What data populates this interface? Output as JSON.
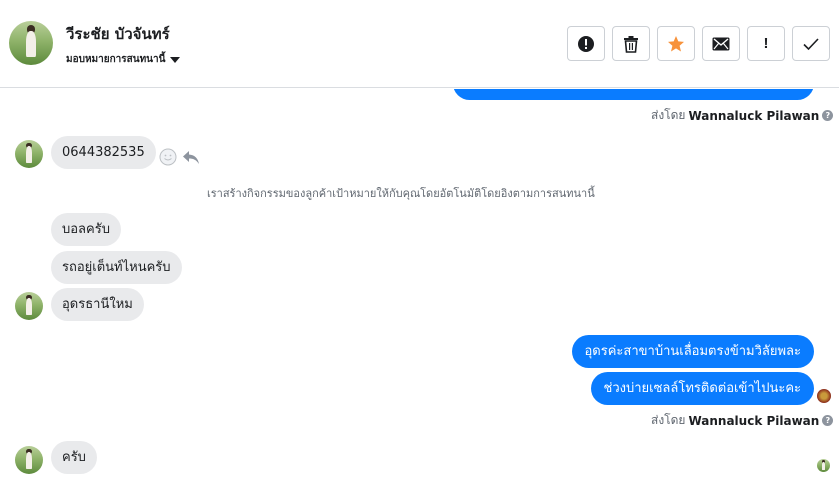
{
  "header": {
    "contact_name": "วีระชัย บัวจันทร์",
    "assign_label": "มอบหมายการสนทนานี้",
    "actions": [
      {
        "name": "report-button",
        "icon": "alert-circle-icon"
      },
      {
        "name": "delete-button",
        "icon": "trash-icon"
      },
      {
        "name": "star-button",
        "icon": "star-icon",
        "color": "#f7923b"
      },
      {
        "name": "mark-unread-button",
        "icon": "envelope-icon"
      },
      {
        "name": "flag-button",
        "icon": "exclamation-icon",
        "text": "!"
      },
      {
        "name": "mark-done-button",
        "icon": "checkmark-icon"
      }
    ]
  },
  "messages": {
    "sent_by_1": {
      "prefix": "ส่งโดย",
      "name": "Wannaluck Pilawan"
    },
    "phone": "0644382535",
    "system_note": "เราสร้างกิจกรรมของลูกค้าเป้าหมายให้กับคุณโดยอัตโนมัติโดยอิงตามการสนทนานี้",
    "in_1": "บอลครับ",
    "in_2": "รถอยู่เต็นท์ไหนครับ",
    "in_3": "อุดรธานีใหม",
    "out_1": "อุดรค่ะสาขาบ้านเลื่อมตรงข้ามวิลัยพละ",
    "out_2": "ช่วงบ่ายเซลล์โทรติดต่อเข้าไปนะคะ",
    "sent_by_2": {
      "prefix": "ส่งโดย",
      "name": "Wannaluck Pilawan"
    },
    "in_4": "ครับ",
    "help_mark": "?"
  },
  "colors": {
    "outgoing_bubble": "#0a7cff",
    "incoming_bubble": "#e9eaec",
    "star": "#f7923b"
  }
}
